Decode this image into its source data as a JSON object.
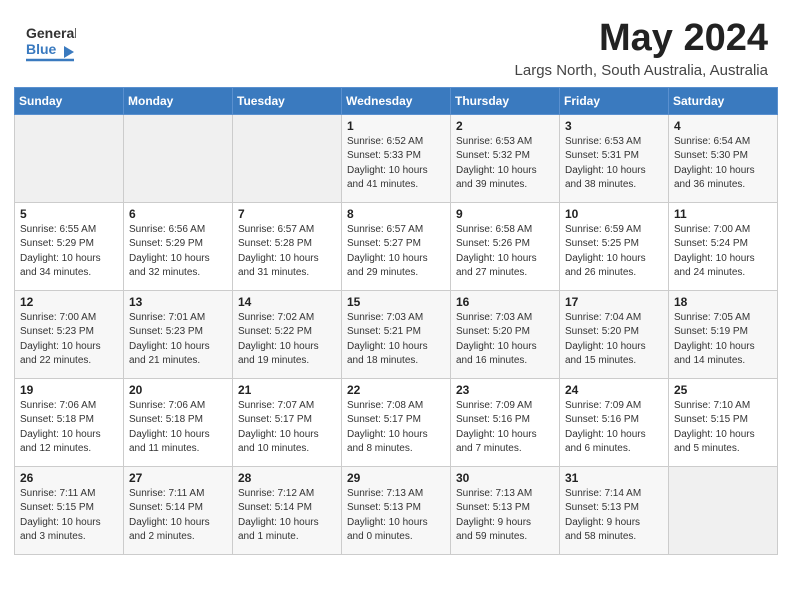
{
  "header": {
    "logo_line1": "General",
    "logo_line2": "Blue",
    "month": "May 2024",
    "location": "Largs North, South Australia, Australia"
  },
  "weekdays": [
    "Sunday",
    "Monday",
    "Tuesday",
    "Wednesday",
    "Thursday",
    "Friday",
    "Saturday"
  ],
  "weeks": [
    [
      {
        "day": "",
        "info": ""
      },
      {
        "day": "",
        "info": ""
      },
      {
        "day": "",
        "info": ""
      },
      {
        "day": "1",
        "info": "Sunrise: 6:52 AM\nSunset: 5:33 PM\nDaylight: 10 hours\nand 41 minutes."
      },
      {
        "day": "2",
        "info": "Sunrise: 6:53 AM\nSunset: 5:32 PM\nDaylight: 10 hours\nand 39 minutes."
      },
      {
        "day": "3",
        "info": "Sunrise: 6:53 AM\nSunset: 5:31 PM\nDaylight: 10 hours\nand 38 minutes."
      },
      {
        "day": "4",
        "info": "Sunrise: 6:54 AM\nSunset: 5:30 PM\nDaylight: 10 hours\nand 36 minutes."
      }
    ],
    [
      {
        "day": "5",
        "info": "Sunrise: 6:55 AM\nSunset: 5:29 PM\nDaylight: 10 hours\nand 34 minutes."
      },
      {
        "day": "6",
        "info": "Sunrise: 6:56 AM\nSunset: 5:29 PM\nDaylight: 10 hours\nand 32 minutes."
      },
      {
        "day": "7",
        "info": "Sunrise: 6:57 AM\nSunset: 5:28 PM\nDaylight: 10 hours\nand 31 minutes."
      },
      {
        "day": "8",
        "info": "Sunrise: 6:57 AM\nSunset: 5:27 PM\nDaylight: 10 hours\nand 29 minutes."
      },
      {
        "day": "9",
        "info": "Sunrise: 6:58 AM\nSunset: 5:26 PM\nDaylight: 10 hours\nand 27 minutes."
      },
      {
        "day": "10",
        "info": "Sunrise: 6:59 AM\nSunset: 5:25 PM\nDaylight: 10 hours\nand 26 minutes."
      },
      {
        "day": "11",
        "info": "Sunrise: 7:00 AM\nSunset: 5:24 PM\nDaylight: 10 hours\nand 24 minutes."
      }
    ],
    [
      {
        "day": "12",
        "info": "Sunrise: 7:00 AM\nSunset: 5:23 PM\nDaylight: 10 hours\nand 22 minutes."
      },
      {
        "day": "13",
        "info": "Sunrise: 7:01 AM\nSunset: 5:23 PM\nDaylight: 10 hours\nand 21 minutes."
      },
      {
        "day": "14",
        "info": "Sunrise: 7:02 AM\nSunset: 5:22 PM\nDaylight: 10 hours\nand 19 minutes."
      },
      {
        "day": "15",
        "info": "Sunrise: 7:03 AM\nSunset: 5:21 PM\nDaylight: 10 hours\nand 18 minutes."
      },
      {
        "day": "16",
        "info": "Sunrise: 7:03 AM\nSunset: 5:20 PM\nDaylight: 10 hours\nand 16 minutes."
      },
      {
        "day": "17",
        "info": "Sunrise: 7:04 AM\nSunset: 5:20 PM\nDaylight: 10 hours\nand 15 minutes."
      },
      {
        "day": "18",
        "info": "Sunrise: 7:05 AM\nSunset: 5:19 PM\nDaylight: 10 hours\nand 14 minutes."
      }
    ],
    [
      {
        "day": "19",
        "info": "Sunrise: 7:06 AM\nSunset: 5:18 PM\nDaylight: 10 hours\nand 12 minutes."
      },
      {
        "day": "20",
        "info": "Sunrise: 7:06 AM\nSunset: 5:18 PM\nDaylight: 10 hours\nand 11 minutes."
      },
      {
        "day": "21",
        "info": "Sunrise: 7:07 AM\nSunset: 5:17 PM\nDaylight: 10 hours\nand 10 minutes."
      },
      {
        "day": "22",
        "info": "Sunrise: 7:08 AM\nSunset: 5:17 PM\nDaylight: 10 hours\nand 8 minutes."
      },
      {
        "day": "23",
        "info": "Sunrise: 7:09 AM\nSunset: 5:16 PM\nDaylight: 10 hours\nand 7 minutes."
      },
      {
        "day": "24",
        "info": "Sunrise: 7:09 AM\nSunset: 5:16 PM\nDaylight: 10 hours\nand 6 minutes."
      },
      {
        "day": "25",
        "info": "Sunrise: 7:10 AM\nSunset: 5:15 PM\nDaylight: 10 hours\nand 5 minutes."
      }
    ],
    [
      {
        "day": "26",
        "info": "Sunrise: 7:11 AM\nSunset: 5:15 PM\nDaylight: 10 hours\nand 3 minutes."
      },
      {
        "day": "27",
        "info": "Sunrise: 7:11 AM\nSunset: 5:14 PM\nDaylight: 10 hours\nand 2 minutes."
      },
      {
        "day": "28",
        "info": "Sunrise: 7:12 AM\nSunset: 5:14 PM\nDaylight: 10 hours\nand 1 minute."
      },
      {
        "day": "29",
        "info": "Sunrise: 7:13 AM\nSunset: 5:13 PM\nDaylight: 10 hours\nand 0 minutes."
      },
      {
        "day": "30",
        "info": "Sunrise: 7:13 AM\nSunset: 5:13 PM\nDaylight: 9 hours\nand 59 minutes."
      },
      {
        "day": "31",
        "info": "Sunrise: 7:14 AM\nSunset: 5:13 PM\nDaylight: 9 hours\nand 58 minutes."
      },
      {
        "day": "",
        "info": ""
      }
    ]
  ]
}
